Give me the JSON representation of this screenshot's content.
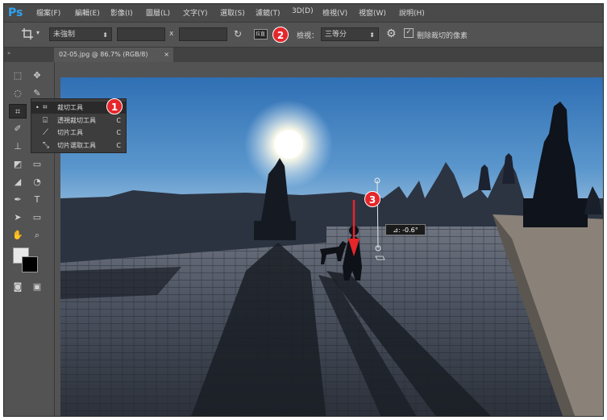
{
  "app": {
    "logo": "Ps"
  },
  "menu": [
    "檔案(F)",
    "編輯(E)",
    "影像(I)",
    "圖層(L)",
    "文字(Y)",
    "選取(S)",
    "濾鏡(T)",
    "3D(D)",
    "檢視(V)",
    "視窗(W)",
    "說明(H)"
  ],
  "options": {
    "tool_icon": "crop-icon",
    "ratio": "未強制",
    "times": "x",
    "straighten_label": "拉直",
    "view_label": "檢視：",
    "view_value": "三等分",
    "delete_pixels_label": "刪除裁切的像素",
    "delete_pixels_checked": true
  },
  "document": {
    "tab_title": "02-05.jpg @ 86.7% (RGB/8)",
    "close": "×"
  },
  "flyout": {
    "items": [
      {
        "label": "裁切工具",
        "key": "C",
        "icon": "crop-icon",
        "selected": true
      },
      {
        "label": "透視裁切工具",
        "key": "C",
        "icon": "perspective-crop-icon",
        "selected": false
      },
      {
        "label": "切片工具",
        "key": "C",
        "icon": "slice-icon",
        "selected": false
      },
      {
        "label": "切片選取工具",
        "key": "C",
        "icon": "slice-select-icon",
        "selected": false
      }
    ]
  },
  "callouts": {
    "one": "1",
    "two": "2",
    "three": "3"
  },
  "canvas": {
    "angle_readout": "⊿: -0.6°"
  }
}
